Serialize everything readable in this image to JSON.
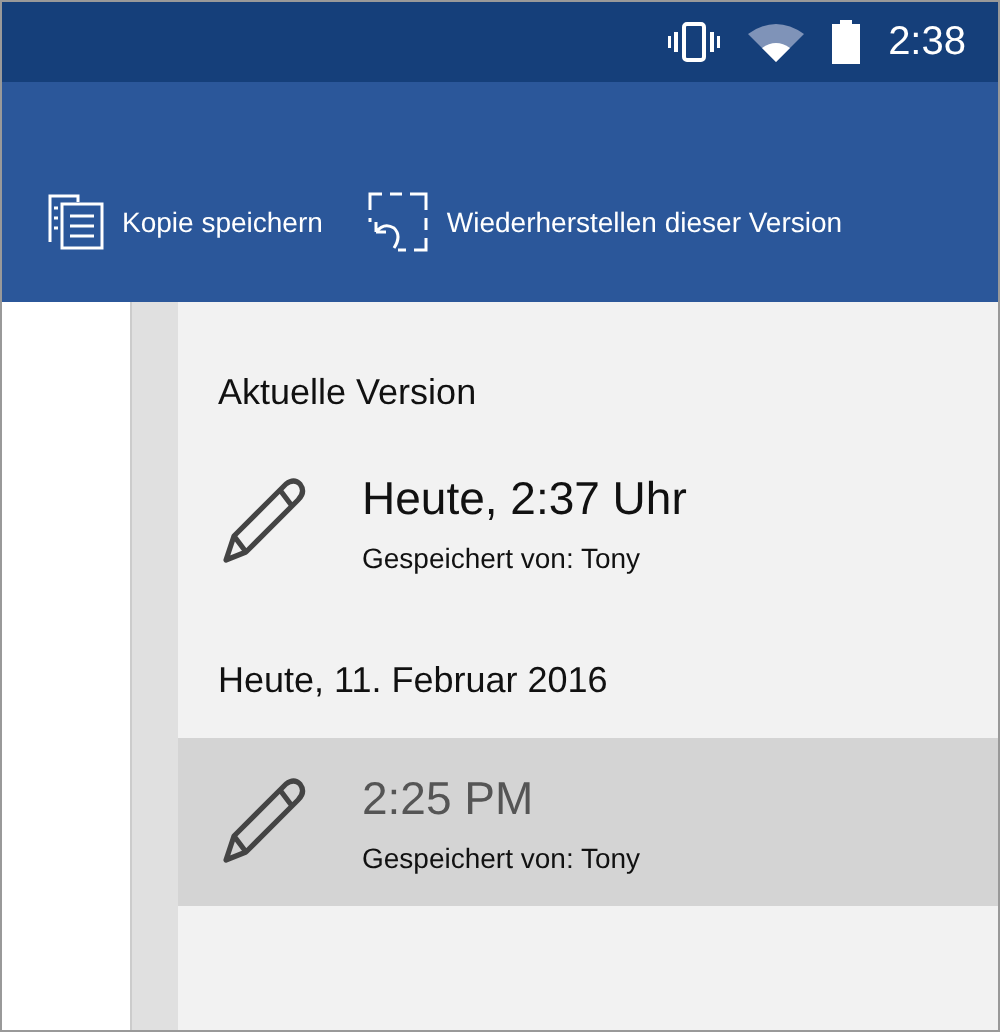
{
  "status_bar": {
    "time": "2:38"
  },
  "toolbar": {
    "buttons": [
      {
        "kind": "copy",
        "label": "Kopie speichern"
      },
      {
        "kind": "restore",
        "label": "Wiederherstellen dieser Version"
      }
    ]
  },
  "versions": [
    {
      "heading": "Aktuelle Version",
      "items": [
        {
          "time": "Heute, 2:37 Uhr",
          "saved_by": "Gespeichert von: Tony",
          "selected": false
        }
      ]
    },
    {
      "heading": "Heute, 11. Februar 2016",
      "items": [
        {
          "time": "2:25 PM",
          "saved_by": "Gespeichert von: Tony",
          "selected": true
        }
      ]
    }
  ]
}
